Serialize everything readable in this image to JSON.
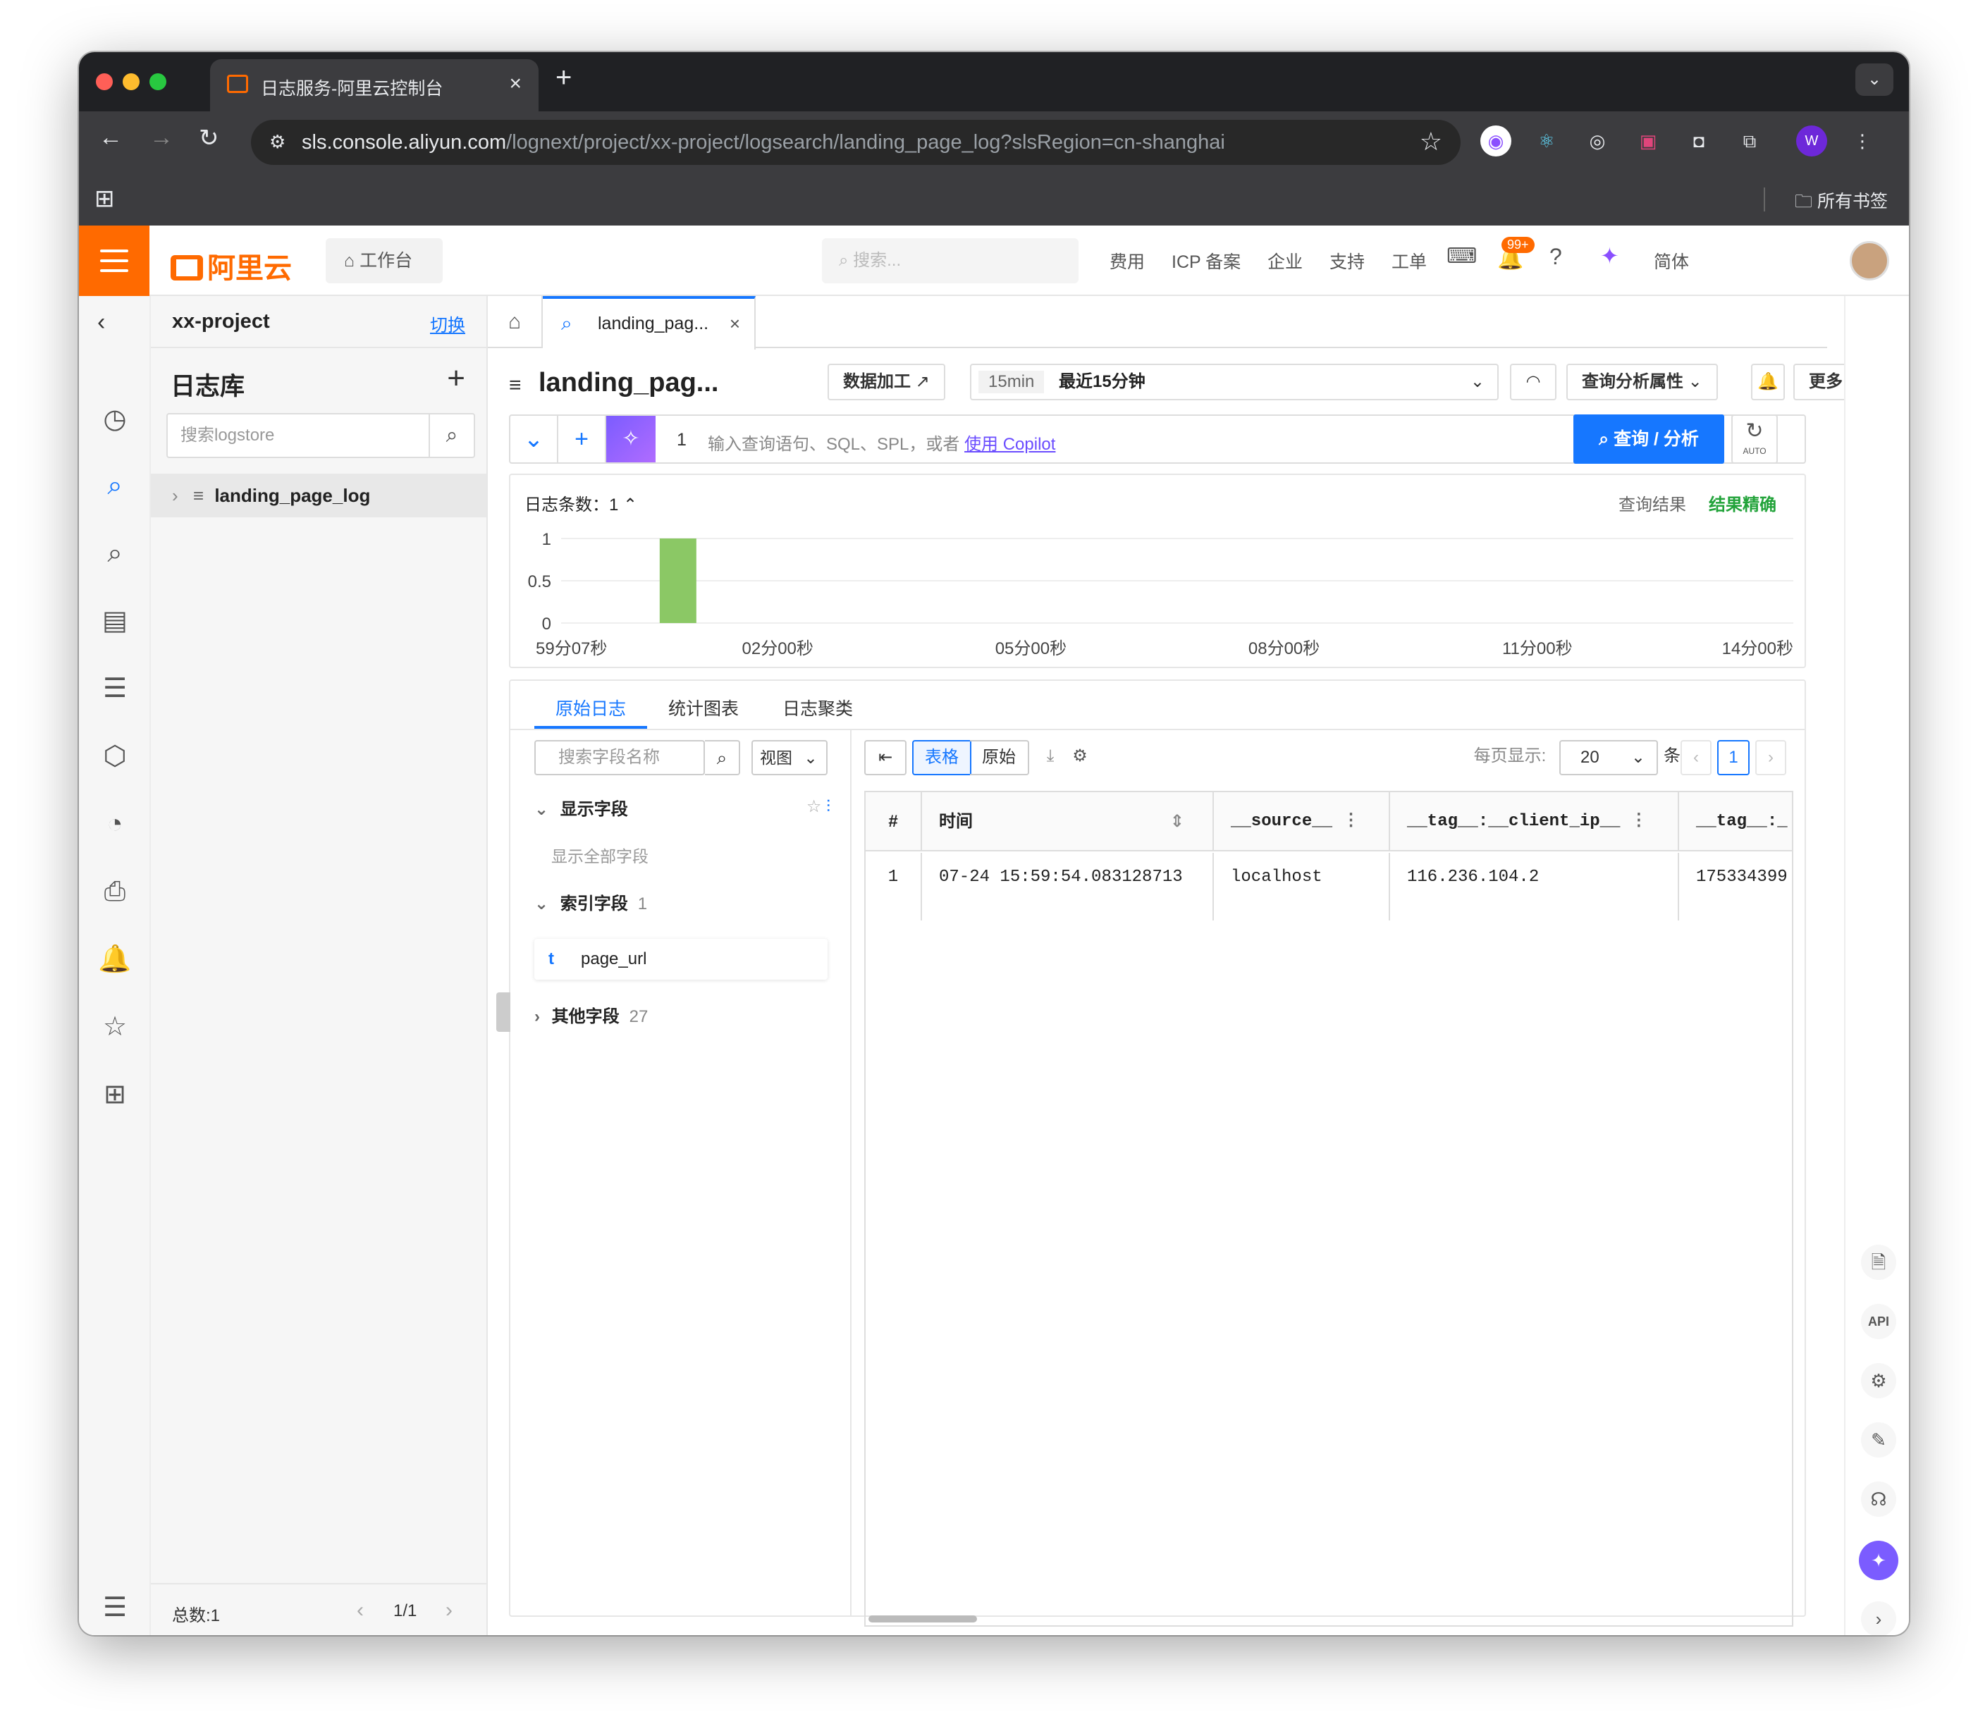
{
  "browser": {
    "tab_title": "日志服务-阿里云控制台",
    "url_host": "sls.console.aliyun.com",
    "url_path": "/lognext/project/xx-project/logsearch/landing_page_log?slsRegion=cn-shanghai",
    "bookmarks_label": "所有书签",
    "profile_initial": "W"
  },
  "topnav": {
    "brand": "阿里云",
    "workbench": "工作台",
    "search_placeholder": "搜索...",
    "links": [
      "费用",
      "ICP 备案",
      "企业",
      "支持",
      "工单"
    ],
    "badge": "99+",
    "lang": "简体"
  },
  "project": {
    "name": "xx-project",
    "switch_label": "切换",
    "logstore_header": "日志库",
    "logstore_search_placeholder": "搜索logstore",
    "logstore_item": "landing_page_log",
    "footer_total": "总数:1",
    "footer_page": "1/1"
  },
  "main": {
    "tab_label": "landing_pag...",
    "title": "landing_pag...",
    "data_process": "数据加工",
    "time_tag": "15min",
    "time_value": "最近15分钟",
    "analysis_props": "查询分析属性",
    "more": "更多",
    "query_line_no": "1",
    "query_placeholder": "输入查询语句、SQL、SPL，或者",
    "copilot_link": "使用 Copilot",
    "submit": "查询 / 分析",
    "auto": "AUTO"
  },
  "histogram": {
    "count_label": "日志条数：1",
    "query_result": "查询结果",
    "accurate": "结果精确",
    "bar_color": "#8bc865"
  },
  "chart_data": {
    "type": "bar",
    "categories": [
      "59分07秒",
      "02分00秒",
      "05分00秒",
      "08分00秒",
      "11分00秒",
      "14分00秒"
    ],
    "y_ticks": [
      "1",
      "0.5",
      "0"
    ],
    "ylim": [
      0,
      1
    ],
    "bars": [
      {
        "x_fraction": 0.08,
        "value": 1
      }
    ]
  },
  "results": {
    "tabs": [
      "原始日志",
      "统计图表",
      "日志聚类"
    ],
    "field_search_placeholder": "搜索字段名称",
    "view_label": "视图",
    "shown_fields": "显示字段",
    "show_all_fields": "显示全部字段",
    "index_fields": "索引字段",
    "index_fields_count": "1",
    "index_field_type": "t",
    "index_field_name": "page_url",
    "other_fields": "其他字段",
    "other_fields_count": "27",
    "view_table": "表格",
    "view_raw": "原始",
    "per_page_label": "每页显示:",
    "per_page_value": "20",
    "per_page_unit": "条",
    "current_page": "1",
    "columns": [
      "#",
      "时间",
      "__source__",
      "__tag__:__client_ip__",
      "__tag__:_"
    ],
    "rows": [
      [
        "1",
        "07-24 15:59:54.083128713",
        "localhost",
        "116.236.104.2",
        "175334399"
      ]
    ]
  }
}
